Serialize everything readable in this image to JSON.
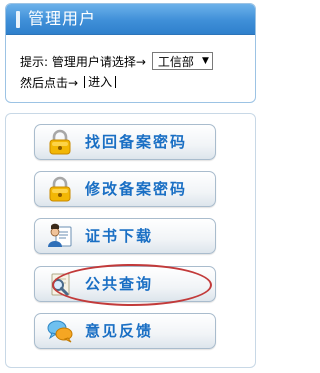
{
  "panel": {
    "title": "管理用户",
    "hint_label": "提示: 管理用户请选择→",
    "dept_select": {
      "selected": "工信部",
      "caret": "▼"
    },
    "then_click": "然后点击→",
    "enter_link": "进入"
  },
  "buttons": [
    {
      "label": "找回备案密码",
      "icon": "lock-icon"
    },
    {
      "label": "修改备案密码",
      "icon": "lock-icon"
    },
    {
      "label": "证书下载",
      "icon": "certificate-download-icon"
    },
    {
      "label": "公共查询",
      "icon": "magnifier-icon"
    },
    {
      "label": "意见反馈",
      "icon": "feedback-chat-icon"
    }
  ],
  "colors": {
    "header": "#3f8fd8",
    "button_text": "#1a6fc4",
    "highlight_ellipse": "#c23a3a"
  }
}
